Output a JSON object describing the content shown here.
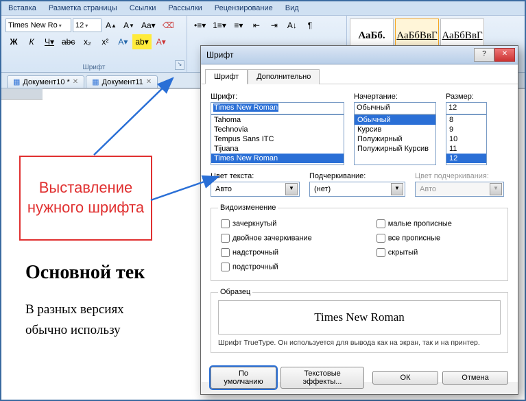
{
  "ribbon": {
    "tabs": [
      "Вставка",
      "Разметка страницы",
      "Ссылки",
      "Рассылки",
      "Рецензирование",
      "Вид"
    ],
    "font_combo": "Times New Ro",
    "size_combo": "12",
    "group_label": "Шрифт",
    "bold": "Ж",
    "italic": "К",
    "underline": "Ч",
    "styles": [
      {
        "preview": "АаБб.",
        "label": ""
      },
      {
        "preview": "АаБбВвГ",
        "label": ""
      },
      {
        "preview": "АаБбВвГ",
        "label": ""
      }
    ]
  },
  "doc_tabs": [
    {
      "label": "Документ10 *"
    },
    {
      "label": "Документ11"
    }
  ],
  "annotation": "Выставление нужного шрифта",
  "doc": {
    "heading": "Основной тек",
    "line1": "В разных версиях",
    "line2": "обычно использу"
  },
  "dialog": {
    "title": "Шрифт",
    "tabs": {
      "font": "Шрифт",
      "advanced": "Дополнительно"
    },
    "labels": {
      "font": "Шрифт:",
      "style": "Начертание:",
      "size": "Размер:",
      "color": "Цвет текста:",
      "underline": "Подчеркивание:",
      "ucolor": "Цвет подчеркивания:",
      "effects": "Видоизменение",
      "sample": "Образец"
    },
    "font_value": "Times New Roman",
    "font_list": [
      "Tahoma",
      "Technovia",
      "Tempus Sans ITC",
      "Tijuana",
      "Times New Roman"
    ],
    "style_value": "Обычный",
    "style_list": [
      "Обычный",
      "Курсив",
      "Полужирный",
      "Полужирный Курсив"
    ],
    "size_value": "12",
    "size_list": [
      "8",
      "9",
      "10",
      "11",
      "12"
    ],
    "color_value": "Авто",
    "underline_value": "(нет)",
    "ucolor_value": "Авто",
    "effects": {
      "strike": "зачеркнутый",
      "dstrike": "двойное зачеркивание",
      "super": "надстрочный",
      "sub": "подстрочный",
      "smallcaps": "малые прописные",
      "allcaps": "все прописные",
      "hidden": "скрытый"
    },
    "sample_text": "Times New Roman",
    "note": "Шрифт TrueType. Он используется для вывода как на экран, так и на принтер.",
    "buttons": {
      "default": "По умолчанию",
      "effects": "Текстовые эффекты...",
      "ok": "ОК",
      "cancel": "Отмена"
    }
  }
}
